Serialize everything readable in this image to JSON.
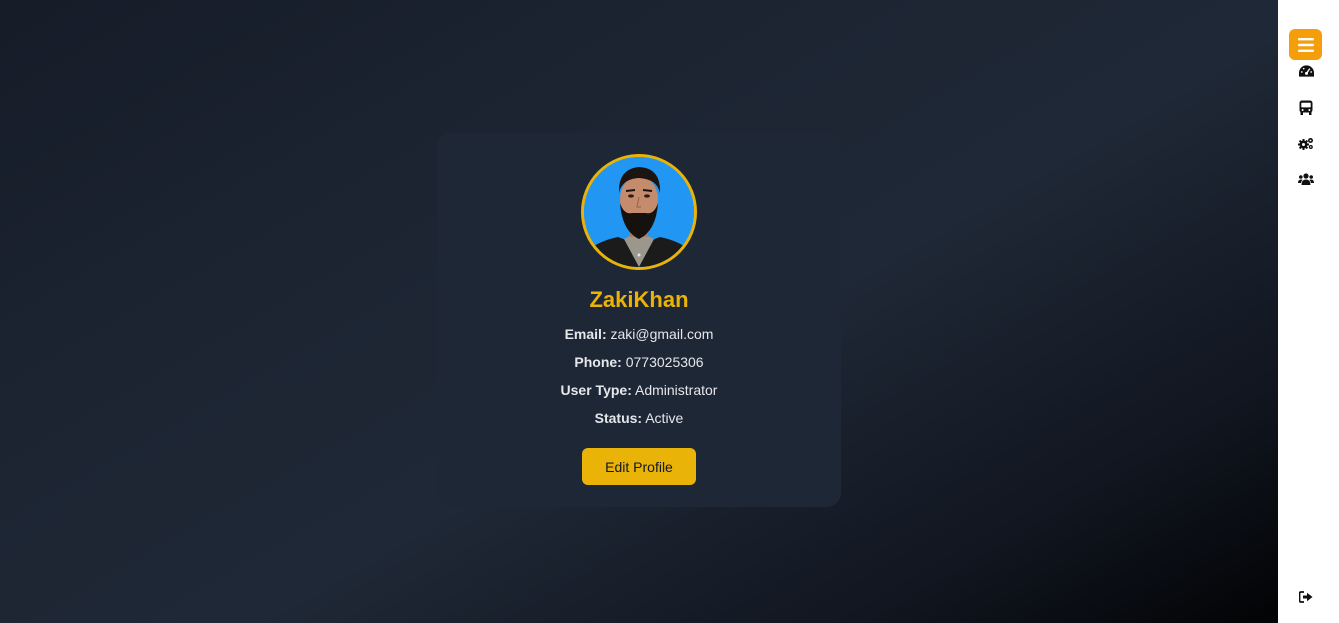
{
  "profile": {
    "name": "ZakiKhan",
    "email_label": "Email:",
    "email": "zaki@gmail.com",
    "phone_label": "Phone:",
    "phone": "0773025306",
    "user_type_label": "User Type:",
    "user_type": "Administrator",
    "status_label": "Status:",
    "status": "Active",
    "edit_button": "Edit Profile"
  },
  "sidebar": {
    "items": [
      {
        "icon": "menu-icon"
      },
      {
        "icon": "dashboard-gauge-icon"
      },
      {
        "icon": "bus-icon"
      },
      {
        "icon": "cogs-icon"
      },
      {
        "icon": "users-icon"
      },
      {
        "icon": "sign-out-icon"
      }
    ]
  },
  "colors": {
    "accent": "#eab308",
    "menu_button": "#f59e0b",
    "card_bg": "#1e2735",
    "avatar_bg": "#2196f3"
  }
}
